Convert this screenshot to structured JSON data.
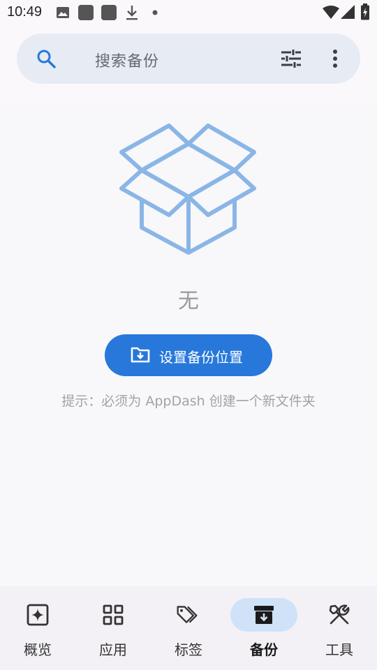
{
  "status_bar": {
    "time": "10:49"
  },
  "search": {
    "placeholder": "搜索备份",
    "icons": [
      "search-icon",
      "filter-icon",
      "more-vert-icon"
    ]
  },
  "empty_state": {
    "title": "无",
    "button_label": "设置备份位置",
    "hint": "提示：必须为 AppDash 创建一个新文件夹",
    "illustration": "open-box-icon"
  },
  "bottom_nav": {
    "items": [
      {
        "label": "概览",
        "icon": "overview-icon",
        "active": false
      },
      {
        "label": "应用",
        "icon": "apps-grid-icon",
        "active": false
      },
      {
        "label": "标签",
        "icon": "tags-icon",
        "active": false
      },
      {
        "label": "备份",
        "icon": "archive-icon",
        "active": true
      },
      {
        "label": "工具",
        "icon": "tools-icon",
        "active": false
      }
    ]
  },
  "colors": {
    "accent": "#2778da",
    "accent_light": "#cfe2f8",
    "illustration": "#8ab6e6",
    "search_bg": "#e6ebf4"
  }
}
